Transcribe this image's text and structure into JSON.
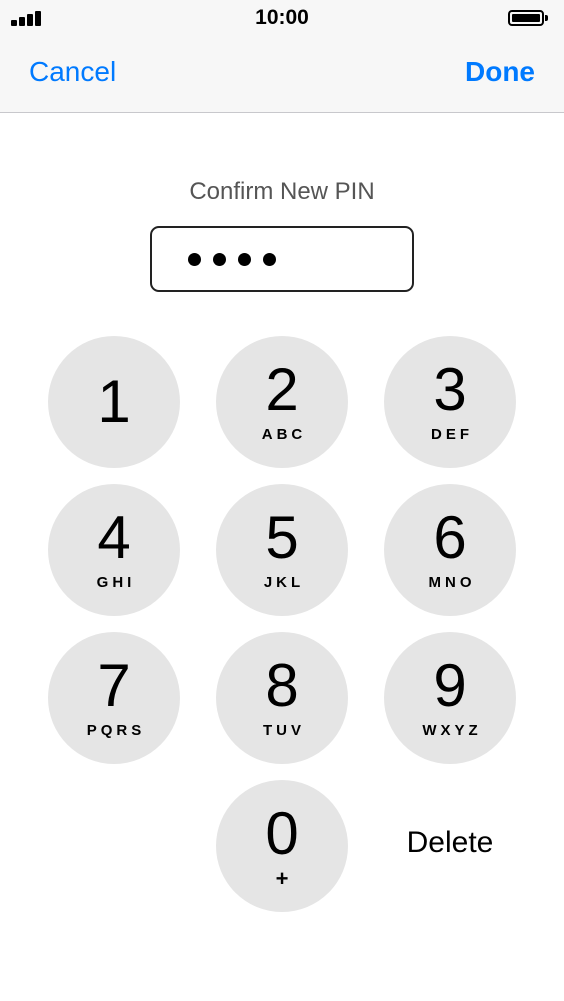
{
  "status_bar": {
    "time": "10:00",
    "signal_icon": "cellular-signal-icon",
    "battery_icon": "battery-icon"
  },
  "nav": {
    "cancel_label": "Cancel",
    "done_label": "Done"
  },
  "pin": {
    "prompt": "Confirm New PIN",
    "entered_digits": 4
  },
  "keypad": {
    "keys": [
      {
        "digit": "1",
        "letters": ""
      },
      {
        "digit": "2",
        "letters": "ABC"
      },
      {
        "digit": "3",
        "letters": "DEF"
      },
      {
        "digit": "4",
        "letters": "GHI"
      },
      {
        "digit": "5",
        "letters": "JKL"
      },
      {
        "digit": "6",
        "letters": "MNO"
      },
      {
        "digit": "7",
        "letters": "PQRS"
      },
      {
        "digit": "8",
        "letters": "TUV"
      },
      {
        "digit": "9",
        "letters": "WXYZ"
      },
      {
        "digit": "0",
        "letters": "+"
      }
    ],
    "delete_label": "Delete"
  },
  "colors": {
    "accent": "#007aff",
    "key_background": "#e5e5e5",
    "bar_background": "#f7f7f7"
  }
}
